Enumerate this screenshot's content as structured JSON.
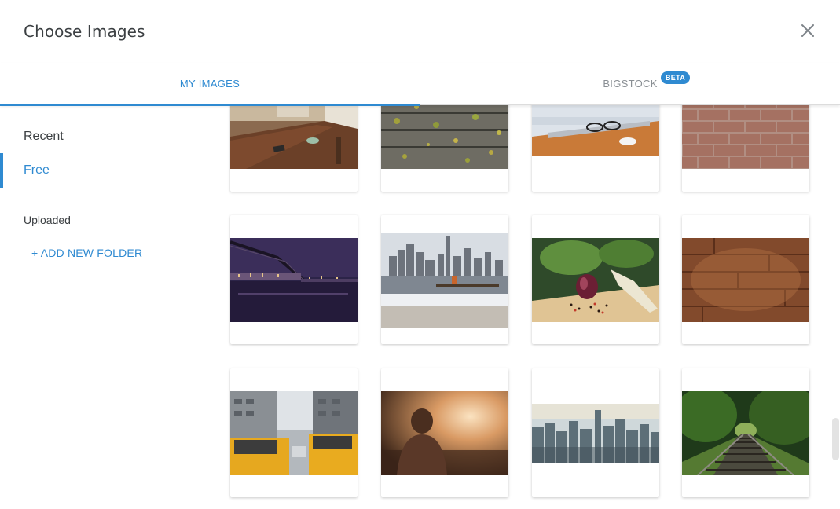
{
  "dialog": {
    "title": "Choose Images",
    "close_icon": "close-icon"
  },
  "tabs": [
    {
      "label": "MY IMAGES",
      "active": true
    },
    {
      "label": "BIGSTOCK",
      "badge": "BETA",
      "active": false
    }
  ],
  "sidebar": {
    "items": [
      {
        "label": "Recent",
        "active": false
      },
      {
        "label": "Free",
        "active": true
      }
    ],
    "section_label": "Uploaded",
    "add_folder_label": "+ ADD NEW FOLDER"
  },
  "images": [
    {
      "subject": "cafe-table"
    },
    {
      "subject": "wooden-planks-leaves"
    },
    {
      "subject": "desk-glasses-mouse"
    },
    {
      "subject": "brick-wall"
    },
    {
      "subject": "bridge-night-city"
    },
    {
      "subject": "city-skyline-winter"
    },
    {
      "subject": "vegetables-cutting-board"
    },
    {
      "subject": "wood-texture"
    },
    {
      "subject": "taxis-city-street"
    },
    {
      "subject": "woman-sunset"
    },
    {
      "subject": "city-aerial-view"
    },
    {
      "subject": "railroad-forest"
    }
  ],
  "colors": {
    "accent": "#2f8ad1",
    "text": "#3c4043",
    "muted": "#8a8f94"
  }
}
